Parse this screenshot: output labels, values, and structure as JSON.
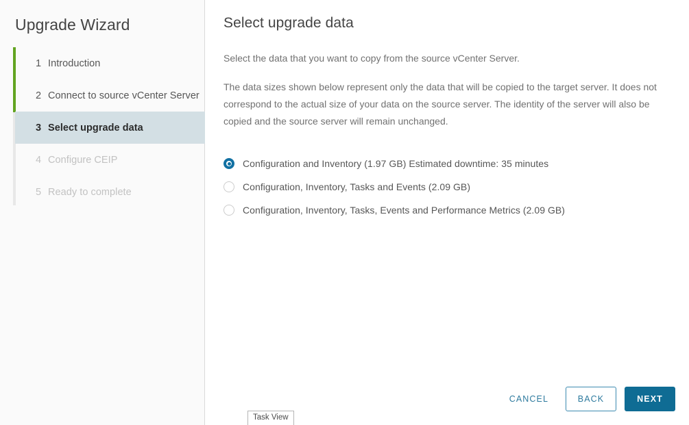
{
  "sidebar": {
    "title": "Upgrade Wizard",
    "steps": [
      {
        "num": "1",
        "label": "Introduction",
        "state": "done"
      },
      {
        "num": "2",
        "label": "Connect to source vCenter Server",
        "state": "done"
      },
      {
        "num": "3",
        "label": "Select upgrade data",
        "state": "active"
      },
      {
        "num": "4",
        "label": "Configure CEIP",
        "state": "disabled"
      },
      {
        "num": "5",
        "label": "Ready to complete",
        "state": "disabled"
      }
    ],
    "progress_color": "#62a420",
    "active_bg": "#d3dfe4"
  },
  "main": {
    "title": "Select upgrade data",
    "intro": "Select the data that you want to copy from the source vCenter Server.",
    "description": "The data sizes shown below represent only the data that will be copied to the target server. It does not correspond to the actual size of your data on the source server. The identity of the server will also be copied and the source server will remain unchanged.",
    "options": [
      {
        "label": "Configuration and Inventory (1.97 GB) Estimated downtime: 35 minutes",
        "checked": true
      },
      {
        "label": "Configuration, Inventory, Tasks and Events (2.09 GB)",
        "checked": false
      },
      {
        "label": "Configuration, Inventory, Tasks, Events and Performance Metrics (2.09 GB)",
        "checked": false
      }
    ]
  },
  "footer": {
    "cancel_label": "CANCEL",
    "back_label": "BACK",
    "next_label": "NEXT",
    "accent_color": "#0f6c94",
    "link_color": "#2d7a9e"
  },
  "taskbar": {
    "task_view_label": "Task View"
  }
}
